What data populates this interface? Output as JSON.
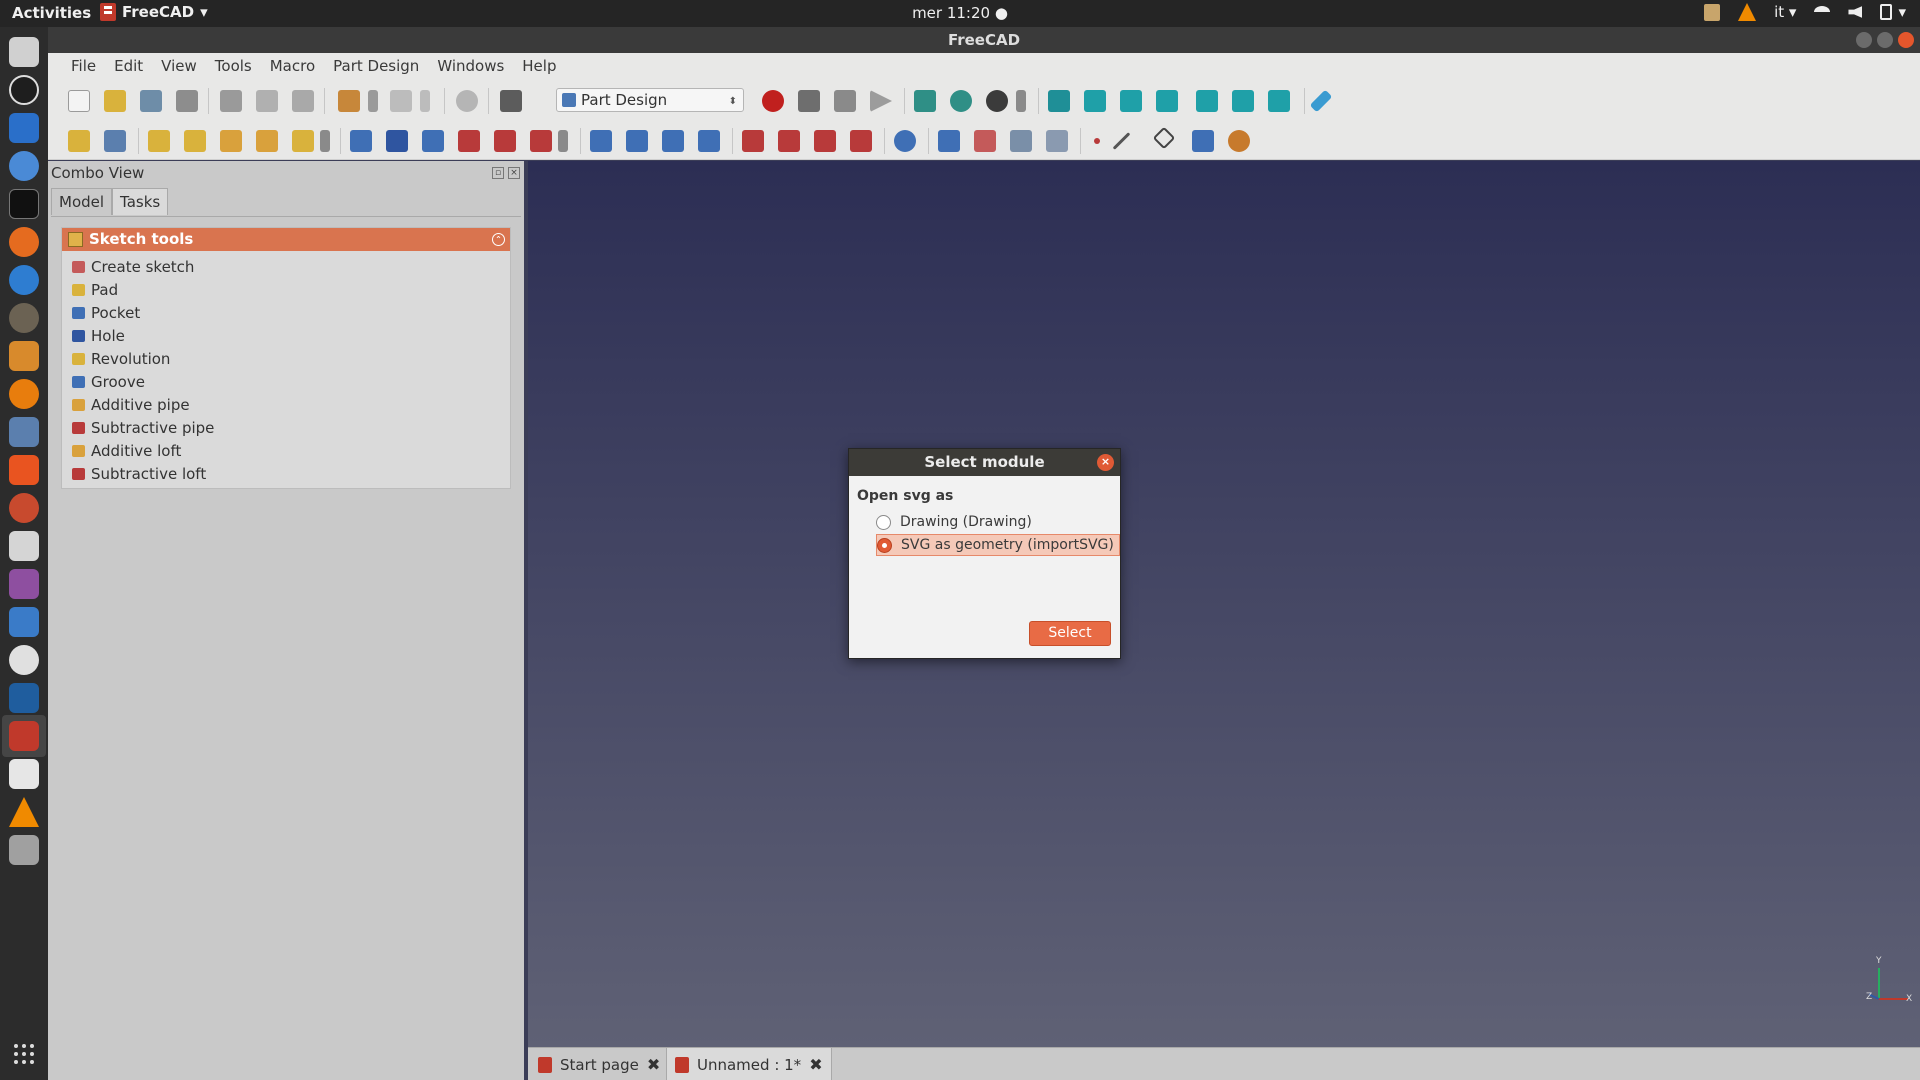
{
  "topbar": {
    "activities": "Activities",
    "app_name": "FreeCAD",
    "app_arrow": "▾",
    "clock": "mer 11:20 ●",
    "lang": "it ▾",
    "power_arrow": "▾"
  },
  "window": {
    "title": "FreeCAD"
  },
  "menubar": {
    "items": [
      "File",
      "Edit",
      "View",
      "Tools",
      "Macro",
      "Part Design",
      "Windows",
      "Help"
    ]
  },
  "toolbar": {
    "workbench_selected": "Part Design",
    "workbench_arrow": "⬍"
  },
  "combo_view": {
    "title": "Combo View",
    "float_btn": "▫",
    "close_btn": "×",
    "tabs": [
      {
        "label": "Model"
      },
      {
        "label": "Tasks"
      }
    ],
    "task_panel": {
      "header": "Sketch tools",
      "collapse": "⌃",
      "items": [
        {
          "label": "Create sketch",
          "color": "#c45a5a"
        },
        {
          "label": "Pad",
          "color": "#d9b23c"
        },
        {
          "label": "Pocket",
          "color": "#3f6fb5"
        },
        {
          "label": "Hole",
          "color": "#2f55a0"
        },
        {
          "label": "Revolution",
          "color": "#d9b23c"
        },
        {
          "label": "Groove",
          "color": "#3f6fb5"
        },
        {
          "label": "Additive pipe",
          "color": "#d9a13c"
        },
        {
          "label": "Subtractive pipe",
          "color": "#b83a3a"
        },
        {
          "label": "Additive loft",
          "color": "#d9a13c"
        },
        {
          "label": "Subtractive loft",
          "color": "#b83a3a"
        }
      ]
    }
  },
  "dialog": {
    "title": "Select module",
    "close": "×",
    "prompt": "Open svg as",
    "options": [
      {
        "label": "Drawing (Drawing)",
        "selected": false
      },
      {
        "label": "SVG as geometry (importSVG)",
        "selected": true
      }
    ],
    "select_label": "Select"
  },
  "axis": {
    "x": "X",
    "y": "Y",
    "z": "Z"
  },
  "doc_tabs": [
    {
      "label": "Start page",
      "close": "✖"
    },
    {
      "label": "Unnamed : 1*",
      "close": "✖"
    }
  ],
  "colors": {
    "accent": "#e05a35",
    "task_header": "#d9744f",
    "view_top": "#2c2e54",
    "view_bottom": "#5f6175"
  }
}
